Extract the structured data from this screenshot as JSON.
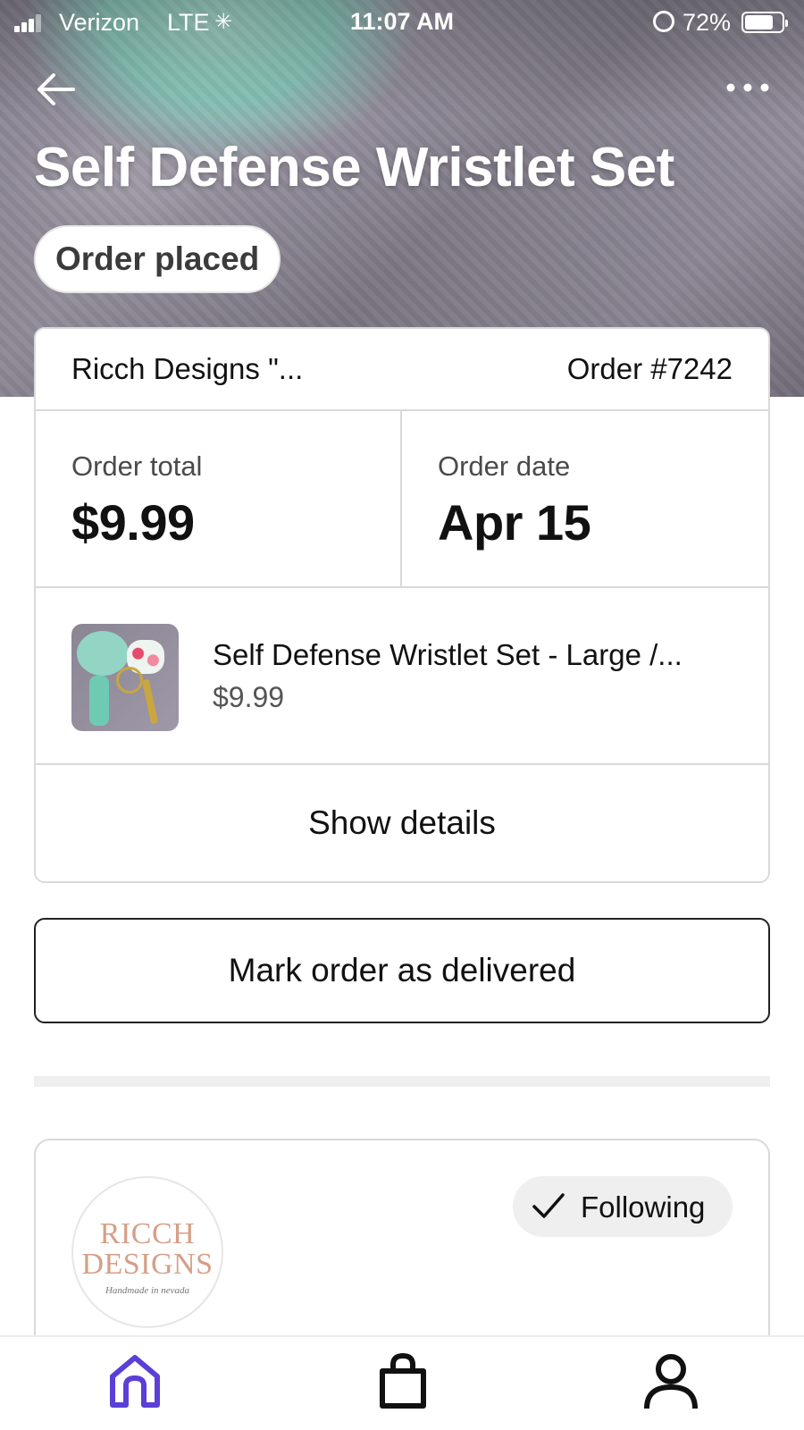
{
  "status_bar": {
    "carrier": "Verizon",
    "network": "LTE",
    "time": "11:07 AM",
    "battery": "72%"
  },
  "header": {
    "title": "Self Defense Wristlet Set",
    "status": "Order placed"
  },
  "order": {
    "shop": "Ricch Designs \"...",
    "number": "Order #7242",
    "total_label": "Order total",
    "total_value": "$9.99",
    "date_label": "Order date",
    "date_value": "Apr 15",
    "item": {
      "name": "Self Defense Wristlet Set - Large /...",
      "price": "$9.99"
    },
    "show_details": "Show details"
  },
  "actions": {
    "mark_delivered": "Mark order as delivered"
  },
  "shop_card": {
    "logo_line1": "RICCH",
    "logo_line2": "DESIGNS",
    "logo_tagline": "Handmade in nevada",
    "follow_label": "Following"
  },
  "tab_bar": {
    "icons": [
      "home-icon",
      "shopping-bag-icon",
      "profile-icon"
    ],
    "active": "home-icon"
  },
  "colors": {
    "accent": "#5b3fd6",
    "logo": "#d69f86"
  }
}
